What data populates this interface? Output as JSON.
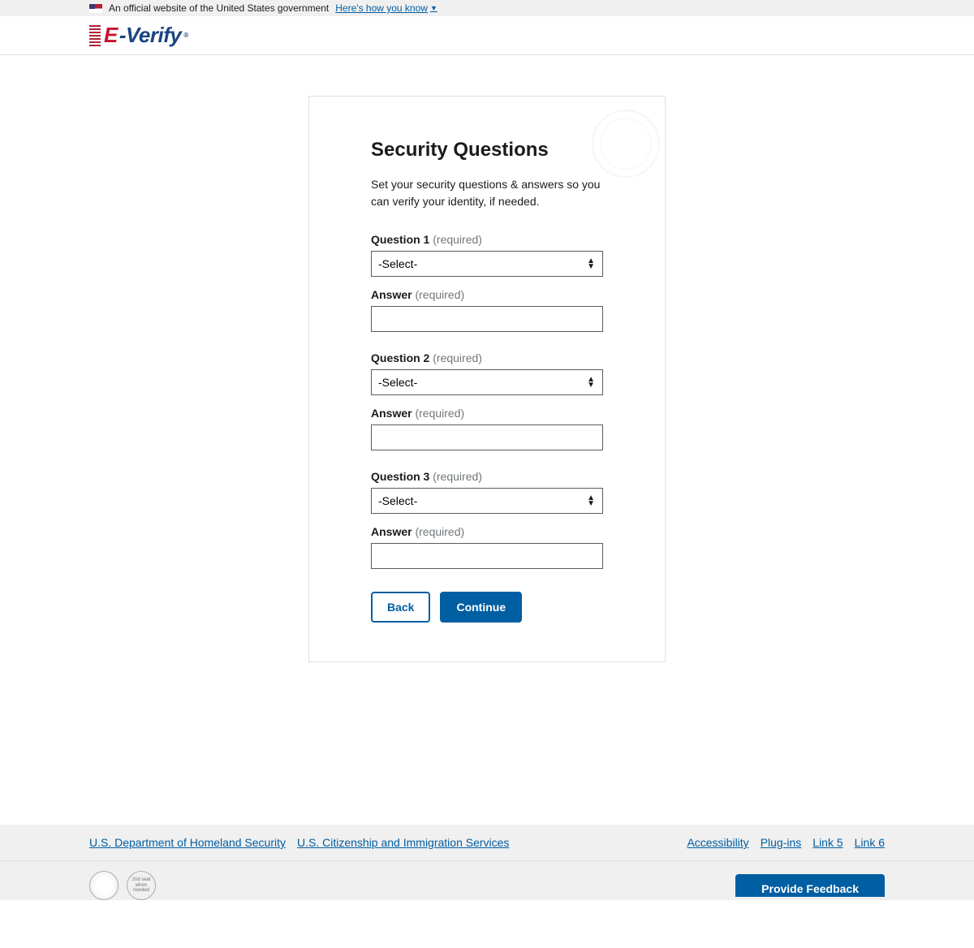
{
  "banner": {
    "text": "An official website of the United States government",
    "link": "Here's how you know"
  },
  "logo": {
    "e": "E",
    "dash": "-",
    "verify": "Verify",
    "r": "®"
  },
  "form": {
    "title": "Security Questions",
    "description": "Set your security questions & answers so you can verify your identity, if needed.",
    "required_label": "(required)",
    "select_placeholder": "-Select-",
    "q1_label": "Question 1",
    "q2_label": "Question 2",
    "q3_label": "Question 3",
    "answer_label": "Answer",
    "back": "Back",
    "continue": "Continue"
  },
  "footer": {
    "left": [
      "U.S. Department of Homeland Security",
      "U.S. Citizenship and Immigration Services"
    ],
    "right": [
      "Accessibility",
      "Plug-ins",
      "Link 5",
      "Link 6"
    ],
    "seal2": "2nd seal when needed",
    "feedback": "Provide Feedback"
  }
}
